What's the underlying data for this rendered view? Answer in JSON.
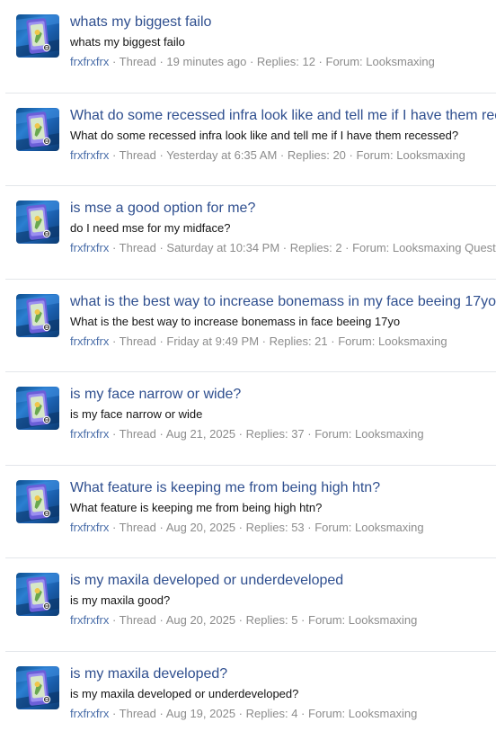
{
  "colors": {
    "title": "#2f4f8f",
    "snippet": "#141414",
    "meta": "#8c8c8c",
    "author": "#4a6ea9",
    "divider": "#e3e6ea"
  },
  "meta_labels": {
    "separator": " · ",
    "thread": "Thread",
    "replies_prefix": "Replies: ",
    "forum_prefix": "Forum: "
  },
  "avatar_icon": "card-avatar-icon",
  "threads": [
    {
      "title": "whats my biggest failo",
      "snippet": "whats my biggest failo",
      "author": "frxfrxfrx",
      "time": "19 minutes ago",
      "replies": "12",
      "forum": "Looksmaxing"
    },
    {
      "title": "What do some recessed infra look like and tell me if I have them recessed?",
      "snippet": "What do some recessed infra look like and tell me if I have them recessed?",
      "author": "frxfrxfrx",
      "time": "Yesterday at 6:35 AM",
      "replies": "20",
      "forum": "Looksmaxing"
    },
    {
      "title": "is mse a good option for me?",
      "snippet": "do I need mse for my midface?",
      "author": "frxfrxfrx",
      "time": "Saturday at 10:34 PM",
      "replies": "2",
      "forum": "Looksmaxing Questions"
    },
    {
      "title": "what is the best way to increase bonemass in my face beeing 17yo",
      "snippet": "What is the best way to increase bonemass in face beeing 17yo",
      "author": "frxfrxfrx",
      "time": "Friday at 9:49 PM",
      "replies": "21",
      "forum": "Looksmaxing"
    },
    {
      "title": "is my face narrow or wide?",
      "snippet": "is my face narrow or wide",
      "author": "frxfrxfrx",
      "time": "Aug 21, 2025",
      "replies": "37",
      "forum": "Looksmaxing"
    },
    {
      "title": "What feature is keeping me from being high htn?",
      "snippet": "What feature is keeping me from being high htn?",
      "author": "frxfrxfrx",
      "time": "Aug 20, 2025",
      "replies": "53",
      "forum": "Looksmaxing"
    },
    {
      "title": "is my maxila developed or underdeveloped",
      "snippet": "is my maxila good?",
      "author": "frxfrxfrx",
      "time": "Aug 20, 2025",
      "replies": "5",
      "forum": "Looksmaxing"
    },
    {
      "title": "is my maxila developed?",
      "snippet": "is my maxila developed or underdeveloped?",
      "author": "frxfrxfrx",
      "time": "Aug 19, 2025",
      "replies": "4",
      "forum": "Looksmaxing"
    }
  ]
}
